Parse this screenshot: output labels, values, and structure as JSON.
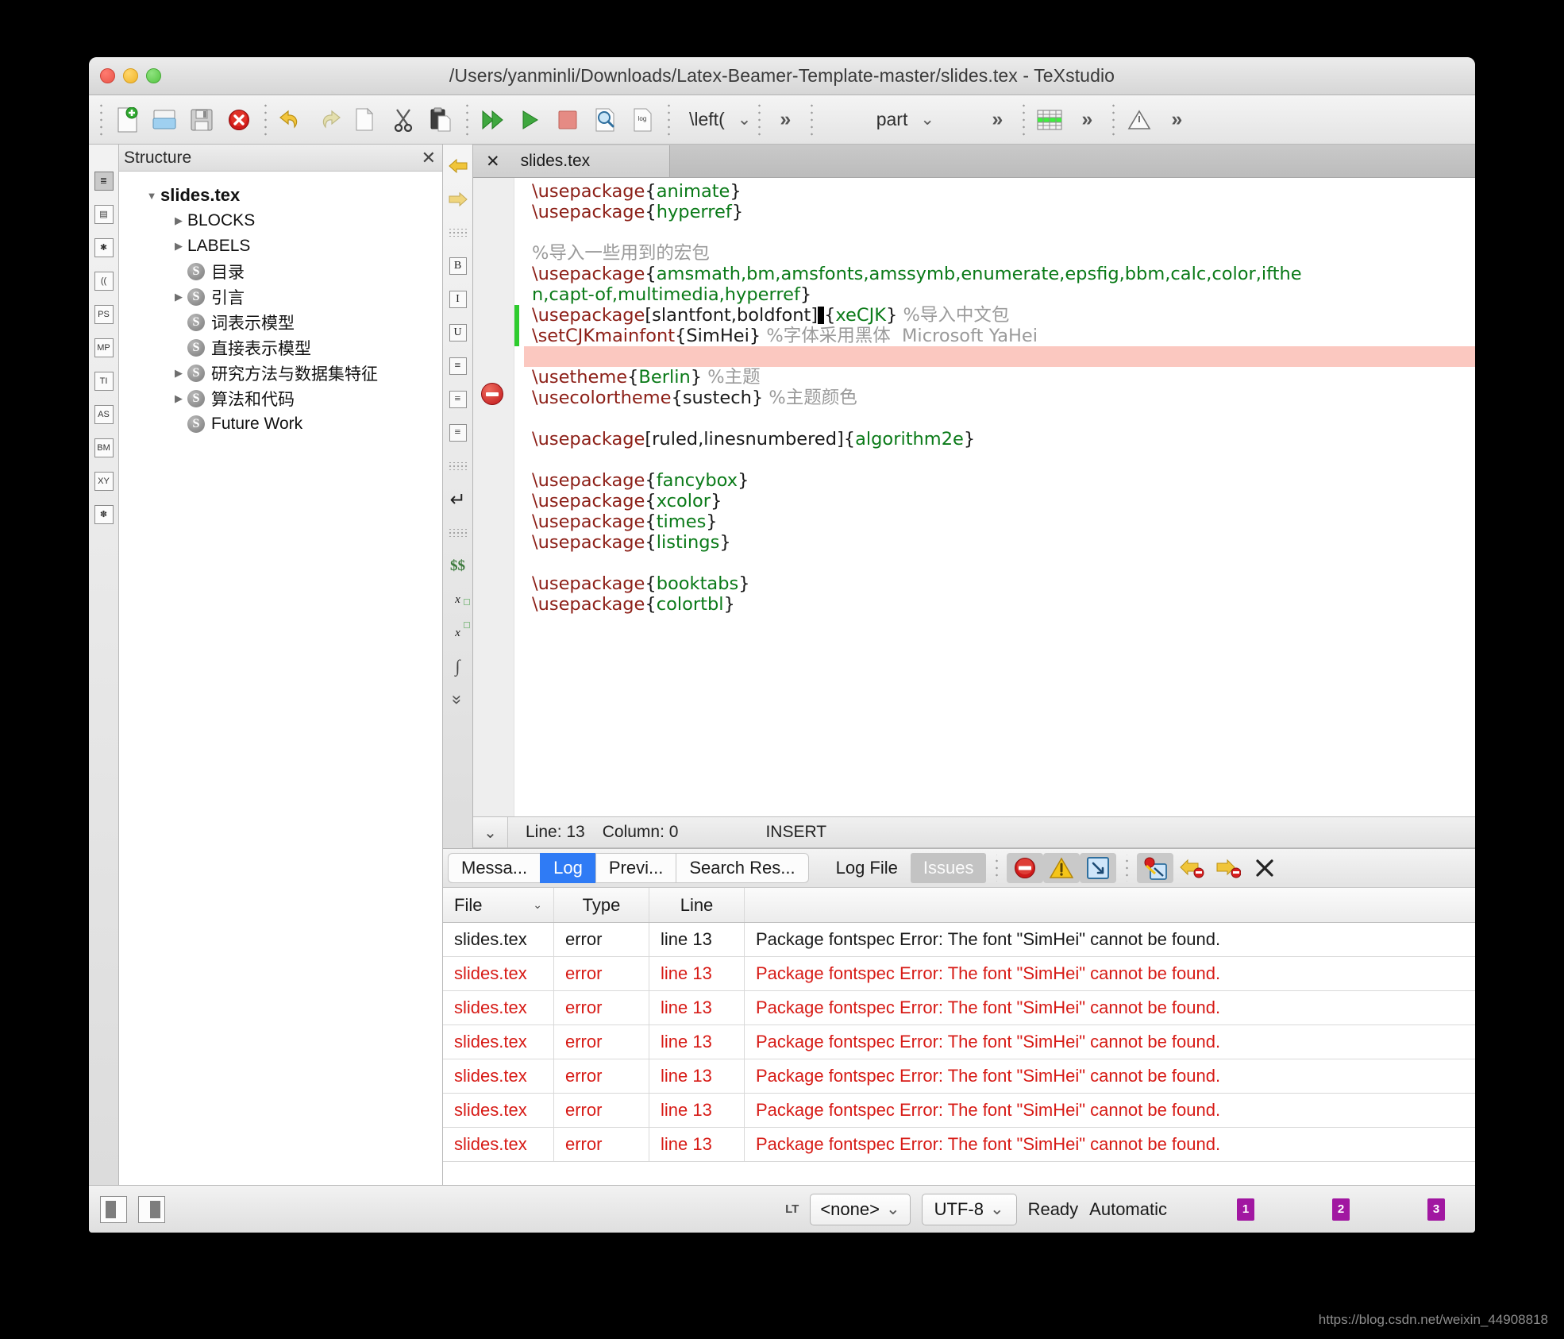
{
  "window": {
    "title": "/Users/yanminli/Downloads/Latex-Beamer-Template-master/slides.tex - TeXstudio"
  },
  "toolbar": {
    "items": [
      {
        "name": "new-document-icon",
        "label": "New"
      },
      {
        "name": "open-document-icon",
        "label": "Open"
      },
      {
        "name": "save-icon",
        "label": "Save"
      },
      {
        "name": "close-document-icon",
        "label": "Close"
      },
      {
        "name": "undo-icon",
        "label": "Undo"
      },
      {
        "name": "redo-icon",
        "label": "Redo"
      },
      {
        "name": "copy-icon",
        "label": "Copy"
      },
      {
        "name": "cut-icon",
        "label": "Cut"
      },
      {
        "name": "paste-icon",
        "label": "Paste"
      },
      {
        "name": "build-and-view-icon",
        "label": "Build & View"
      },
      {
        "name": "compile-icon",
        "label": "Compile"
      },
      {
        "name": "stop-icon",
        "label": "Stop"
      },
      {
        "name": "view-log-icon",
        "label": "View Log"
      },
      {
        "name": "log-file-icon",
        "label": "Log"
      }
    ],
    "left_delim_label": "\\left(",
    "structure_level_label": "part",
    "table-icon": "insert-table-icon",
    "math-icon": "math-warning-icon",
    "more_label": "»",
    "chevron_label": "⌄"
  },
  "rail": {
    "items": [
      {
        "name": "structure-view-icon",
        "glyph": "≣",
        "selected": true
      },
      {
        "name": "bookmarks-view-icon",
        "glyph": "▤",
        "selected": false
      },
      {
        "name": "symbols-view-icon",
        "glyph": "✱",
        "selected": false
      },
      {
        "name": "brackets-view-icon",
        "glyph": "((",
        "selected": false
      },
      {
        "name": "ps-symbols-icon",
        "glyph": "PS",
        "selected": false
      },
      {
        "name": "mp-symbols-icon",
        "glyph": "MP",
        "selected": false
      },
      {
        "name": "ti-symbols-icon",
        "glyph": "TI",
        "selected": false
      },
      {
        "name": "as-symbols-icon",
        "glyph": "AS",
        "selected": false
      },
      {
        "name": "bm-symbols-icon",
        "glyph": "BM",
        "selected": false
      },
      {
        "name": "xy-symbols-icon",
        "glyph": "XY",
        "selected": false
      },
      {
        "name": "favorites-icon",
        "glyph": "✽",
        "selected": false
      }
    ]
  },
  "structure": {
    "title": "Structure",
    "close_label": "✕",
    "tree": [
      {
        "label": "slides.tex",
        "arrow": "down",
        "icon": false,
        "indent": 0,
        "root": true
      },
      {
        "label": "BLOCKS",
        "arrow": "right",
        "icon": false,
        "indent": 1,
        "root": false
      },
      {
        "label": "LABELS",
        "arrow": "right",
        "icon": false,
        "indent": 1,
        "root": false
      },
      {
        "label": "目录",
        "arrow": "none",
        "icon": true,
        "indent": 1,
        "root": false
      },
      {
        "label": "引言",
        "arrow": "right",
        "icon": true,
        "indent": 1,
        "root": false
      },
      {
        "label": "词表示模型",
        "arrow": "none",
        "icon": true,
        "indent": 1,
        "root": false
      },
      {
        "label": "直接表示模型",
        "arrow": "none",
        "icon": true,
        "indent": 1,
        "root": false
      },
      {
        "label": "研究方法与数据集特征",
        "arrow": "right",
        "icon": true,
        "indent": 1,
        "root": false
      },
      {
        "label": "算法和代码",
        "arrow": "right",
        "icon": true,
        "indent": 1,
        "root": false
      },
      {
        "label": "Future Work",
        "arrow": "none",
        "icon": true,
        "indent": 1,
        "root": false
      }
    ],
    "section_icon_letter": "S"
  },
  "vtoolbar": {
    "items": [
      {
        "name": "arrow-left-icon",
        "glyph": "←"
      },
      {
        "name": "arrow-right-icon",
        "glyph": "→"
      },
      {
        "name": "separator-icon",
        "glyph": ""
      },
      {
        "name": "bold-icon",
        "glyph": "B"
      },
      {
        "name": "italic-icon",
        "glyph": "I"
      },
      {
        "name": "underline-icon",
        "glyph": "U"
      },
      {
        "name": "align-left-icon",
        "glyph": "≡"
      },
      {
        "name": "align-center-icon",
        "glyph": "≡"
      },
      {
        "name": "align-right-icon",
        "glyph": "≡"
      },
      {
        "name": "separator-icon",
        "glyph": ""
      },
      {
        "name": "newline-icon",
        "glyph": "↵"
      },
      {
        "name": "separator-icon",
        "glyph": ""
      },
      {
        "name": "inline-math-icon",
        "glyph": "$$"
      },
      {
        "name": "subscript-icon",
        "glyph": "xₐ"
      },
      {
        "name": "superscript-icon",
        "glyph": "xⁿ"
      },
      {
        "name": "integral-icon",
        "glyph": "∫"
      },
      {
        "name": "collapse-all-icon",
        "glyph": "⌄"
      }
    ]
  },
  "editor": {
    "tab_label": "slides.tex",
    "tab_close": "✕",
    "status": {
      "collapse_glyph": "⌄",
      "line_label": "Line: 13",
      "column_label": "Column: 0",
      "mode_label": "INSERT"
    },
    "lines": [
      {
        "type": "code",
        "changed": false,
        "parts": [
          {
            "c": "cmd",
            "t": "\\usepackage"
          },
          {
            "c": "brace",
            "t": "{"
          },
          {
            "c": "arg",
            "t": "animate"
          },
          {
            "c": "brace",
            "t": "}"
          }
        ]
      },
      {
        "type": "code",
        "changed": false,
        "parts": [
          {
            "c": "cmd",
            "t": "\\usepackage"
          },
          {
            "c": "brace",
            "t": "{"
          },
          {
            "c": "arg",
            "t": "hyperref"
          },
          {
            "c": "brace",
            "t": "}"
          }
        ]
      },
      {
        "type": "blank",
        "changed": false,
        "parts": []
      },
      {
        "type": "code",
        "changed": false,
        "parts": [
          {
            "c": "cmt",
            "t": "%导入一些用到的宏包"
          }
        ]
      },
      {
        "type": "code",
        "changed": false,
        "parts": [
          {
            "c": "cmd",
            "t": "\\usepackage"
          },
          {
            "c": "brace",
            "t": "{"
          },
          {
            "c": "arg",
            "t": "amsmath,bm,amsfonts,amssymb,enumerate,epsfig,bbm,calc,color,ifthe"
          }
        ]
      },
      {
        "type": "code",
        "changed": false,
        "parts": [
          {
            "c": "arg",
            "t": "n,capt-of,multimedia,hyperref"
          },
          {
            "c": "brace",
            "t": "}"
          }
        ]
      },
      {
        "type": "code",
        "changed": true,
        "parts": [
          {
            "c": "cmd",
            "t": "\\usepackage"
          },
          {
            "c": "plain",
            "t": "[slantfont,boldfont]"
          },
          {
            "c": "caret",
            "t": ""
          },
          {
            "c": "brace",
            "t": "{"
          },
          {
            "c": "arg",
            "t": "xeCJK"
          },
          {
            "c": "brace",
            "t": "}"
          },
          {
            "c": "cmt",
            "t": " %导入中文包"
          }
        ]
      },
      {
        "type": "code",
        "changed": true,
        "parts": [
          {
            "c": "cmd",
            "t": "\\setCJKmainfont"
          },
          {
            "c": "brace",
            "t": "{"
          },
          {
            "c": "plain",
            "t": "SimHei"
          },
          {
            "c": "brace",
            "t": "}"
          },
          {
            "c": "cmt",
            "t": " %字体采用黑体  Microsoft YaHei"
          }
        ]
      },
      {
        "type": "error",
        "changed": false,
        "parts": []
      },
      {
        "type": "code",
        "changed": false,
        "parts": [
          {
            "c": "cmd",
            "t": "\\usetheme"
          },
          {
            "c": "brace",
            "t": "{"
          },
          {
            "c": "arg",
            "t": "Berlin"
          },
          {
            "c": "brace",
            "t": "}"
          },
          {
            "c": "cmt",
            "t": " %主题"
          }
        ]
      },
      {
        "type": "code",
        "changed": false,
        "parts": [
          {
            "c": "cmd",
            "t": "\\usecolortheme"
          },
          {
            "c": "brace",
            "t": "{"
          },
          {
            "c": "plain",
            "t": "sustech"
          },
          {
            "c": "brace",
            "t": "}"
          },
          {
            "c": "cmt",
            "t": " %主题颜色"
          }
        ]
      },
      {
        "type": "blank",
        "changed": false,
        "parts": []
      },
      {
        "type": "code",
        "changed": false,
        "parts": [
          {
            "c": "cmd",
            "t": "\\usepackage"
          },
          {
            "c": "plain",
            "t": "[ruled,linesnumbered]"
          },
          {
            "c": "brace",
            "t": "{"
          },
          {
            "c": "arg",
            "t": "algorithm2e"
          },
          {
            "c": "brace",
            "t": "}"
          }
        ]
      },
      {
        "type": "blank",
        "changed": false,
        "parts": []
      },
      {
        "type": "code",
        "changed": false,
        "parts": [
          {
            "c": "cmd",
            "t": "\\usepackage"
          },
          {
            "c": "brace",
            "t": "{"
          },
          {
            "c": "arg",
            "t": "fancybox"
          },
          {
            "c": "brace",
            "t": "}"
          }
        ]
      },
      {
        "type": "code",
        "changed": false,
        "parts": [
          {
            "c": "cmd",
            "t": "\\usepackage"
          },
          {
            "c": "brace",
            "t": "{"
          },
          {
            "c": "arg",
            "t": "xcolor"
          },
          {
            "c": "brace",
            "t": "}"
          }
        ]
      },
      {
        "type": "code",
        "changed": false,
        "parts": [
          {
            "c": "cmd",
            "t": "\\usepackage"
          },
          {
            "c": "brace",
            "t": "{"
          },
          {
            "c": "arg",
            "t": "times"
          },
          {
            "c": "brace",
            "t": "}"
          }
        ]
      },
      {
        "type": "code",
        "changed": false,
        "parts": [
          {
            "c": "cmd",
            "t": "\\usepackage"
          },
          {
            "c": "brace",
            "t": "{"
          },
          {
            "c": "arg",
            "t": "listings"
          },
          {
            "c": "brace",
            "t": "}"
          }
        ]
      },
      {
        "type": "blank",
        "changed": false,
        "parts": []
      },
      {
        "type": "code",
        "changed": false,
        "parts": [
          {
            "c": "cmd",
            "t": "\\usepackage"
          },
          {
            "c": "brace",
            "t": "{"
          },
          {
            "c": "arg",
            "t": "booktabs"
          },
          {
            "c": "brace",
            "t": "}"
          }
        ]
      },
      {
        "type": "code",
        "changed": false,
        "parts": [
          {
            "c": "cmd",
            "t": "\\usepackage"
          },
          {
            "c": "brace",
            "t": "{"
          },
          {
            "c": "arg",
            "t": "colortbl"
          },
          {
            "c": "brace",
            "t": "}"
          }
        ]
      }
    ]
  },
  "logpanel": {
    "tabs": [
      {
        "label": "Messa...",
        "style": "group",
        "active": false
      },
      {
        "label": "Log",
        "style": "group",
        "active": true
      },
      {
        "label": "Previ...",
        "style": "group",
        "active": false
      },
      {
        "label": "Search Res...",
        "style": "group-last",
        "active": false
      },
      {
        "label": "Log File",
        "style": "flat",
        "active": false
      },
      {
        "label": "Issues",
        "style": "grey",
        "active": false
      }
    ],
    "buttons": [
      {
        "name": "error-filter-icon",
        "on": true
      },
      {
        "name": "warning-filter-icon",
        "on": true
      },
      {
        "name": "badbox-filter-icon",
        "on": true
      },
      {
        "name": "goto-issue-icon",
        "on": true
      },
      {
        "name": "previous-error-icon",
        "on": false
      },
      {
        "name": "next-error-icon",
        "on": false
      },
      {
        "name": "close-log-icon",
        "on": false
      }
    ],
    "close_label": "✕",
    "columns": [
      "File",
      "Type",
      "Line",
      ""
    ],
    "column_chevron": "⌄",
    "rows": [
      {
        "file": "slides.tex",
        "type": "error",
        "line": "line 13",
        "message": "Package fontspec Error: The font \"SimHei\" cannot be found.",
        "selected": true
      },
      {
        "file": "slides.tex",
        "type": "error",
        "line": "line 13",
        "message": "Package fontspec Error: The font \"SimHei\" cannot be found.",
        "selected": false
      },
      {
        "file": "slides.tex",
        "type": "error",
        "line": "line 13",
        "message": "Package fontspec Error: The font \"SimHei\" cannot be found.",
        "selected": false
      },
      {
        "file": "slides.tex",
        "type": "error",
        "line": "line 13",
        "message": "Package fontspec Error: The font \"SimHei\" cannot be found.",
        "selected": false
      },
      {
        "file": "slides.tex",
        "type": "error",
        "line": "line 13",
        "message": "Package fontspec Error: The font \"SimHei\" cannot be found.",
        "selected": false
      },
      {
        "file": "slides.tex",
        "type": "error",
        "line": "line 13",
        "message": "Package fontspec Error: The font \"SimHei\" cannot be found.",
        "selected": false
      },
      {
        "file": "slides.tex",
        "type": "error",
        "line": "line 13",
        "message": "Package fontspec Error: The font \"SimHei\" cannot be found.",
        "selected": false
      }
    ]
  },
  "statusbar": {
    "lt_label": "LT",
    "language_value": "<none>",
    "encoding_value": "UTF-8",
    "ready_label": "Ready",
    "automatic_label": "Automatic",
    "indicators": [
      "1",
      "2",
      "3"
    ],
    "chevron": "⌄"
  },
  "watermark": "https://blog.csdn.net/weixin_44908818",
  "colors": {
    "accent": "#2f7bf5",
    "error": "#d71b16",
    "command": "#8c1f17",
    "argument": "#0a7a18",
    "comment": "#9a9a9a",
    "error_line_bg": "#fbc8c0",
    "changed_marker": "#2ecc2e"
  }
}
